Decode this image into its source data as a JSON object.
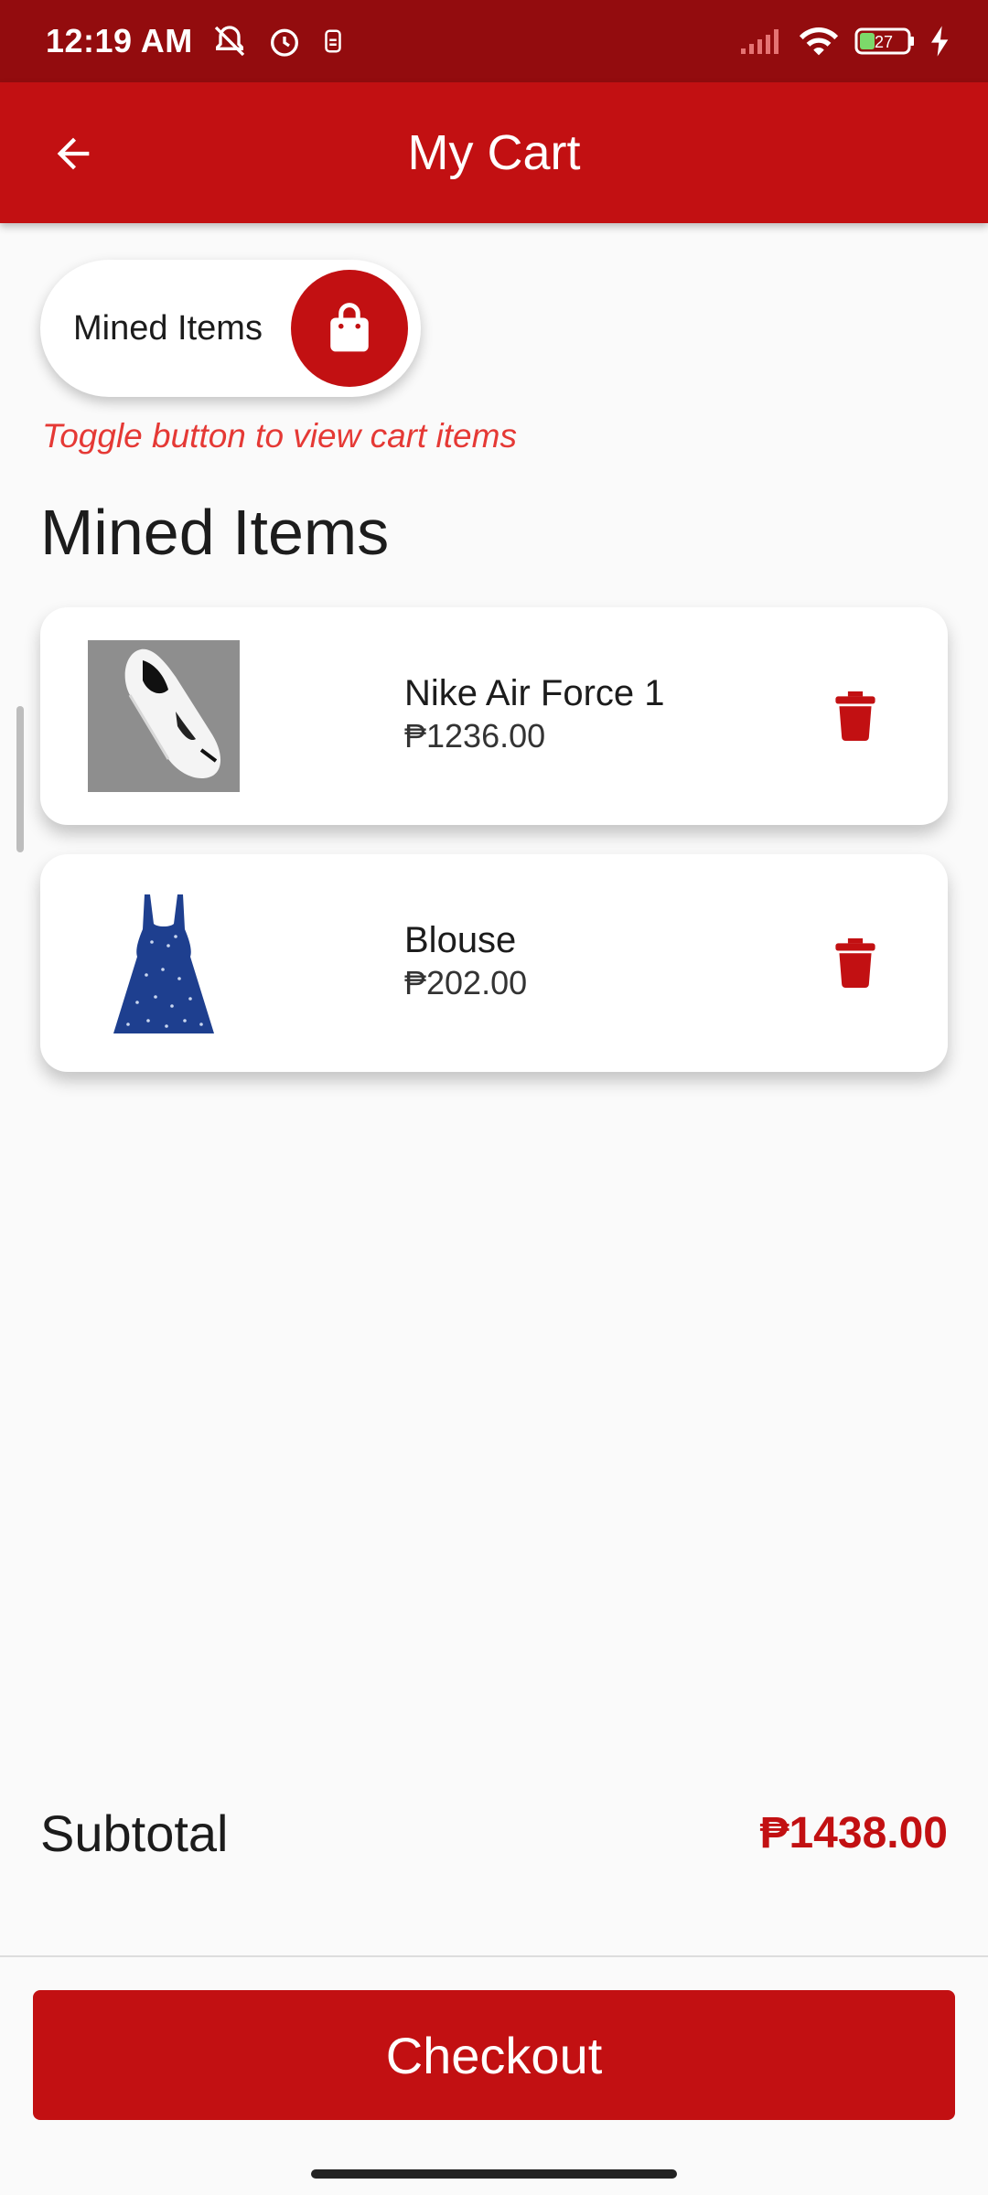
{
  "status_bar": {
    "time": "12:19 AM",
    "battery_level": "27"
  },
  "app_bar": {
    "title": "My Cart"
  },
  "toggle": {
    "label": "Mined Items"
  },
  "hint": "Toggle button to view cart items",
  "section_title": "Mined Items",
  "cart": {
    "items": [
      {
        "name": "Nike Air Force 1",
        "price": "₱1236.00",
        "thumb_icon": "sneaker-image"
      },
      {
        "name": "Blouse",
        "price": "₱202.00",
        "thumb_icon": "dress-image"
      }
    ]
  },
  "subtotal": {
    "label": "Subtotal",
    "value": "₱1438.00"
  },
  "checkout": {
    "label": "Checkout"
  },
  "colors": {
    "primary": "#c21012",
    "status_bar": "#930c0e",
    "hint": "#e53935"
  }
}
